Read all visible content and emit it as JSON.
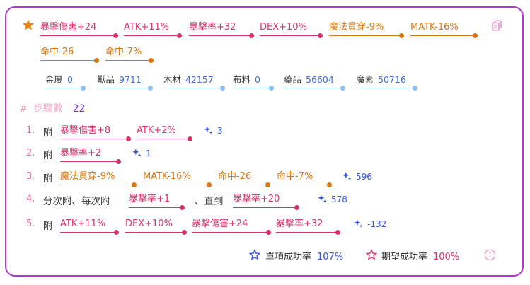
{
  "top_stats": [
    {
      "text": "暴擊傷害+24",
      "color": "pink"
    },
    {
      "text": "ATK+11%",
      "color": "pink"
    },
    {
      "text": "暴擊率+32",
      "color": "pink"
    },
    {
      "text": "DEX+10%",
      "color": "pink"
    },
    {
      "text": "魔法貫穿-9%",
      "color": "orange"
    },
    {
      "text": "MATK-16%",
      "color": "orange"
    },
    {
      "text": "命中-26",
      "color": "orange"
    },
    {
      "text": "命中-7%",
      "color": "orange"
    }
  ],
  "materials": [
    {
      "name": "金屬",
      "value": "0"
    },
    {
      "name": "獸品",
      "value": "9711"
    },
    {
      "name": "木材",
      "value": "42157"
    },
    {
      "name": "布料",
      "value": "0"
    },
    {
      "name": "藥品",
      "value": "56604"
    },
    {
      "name": "魔素",
      "value": "50716"
    }
  ],
  "steps_label": "步驟數",
  "steps_hash": "#",
  "steps_count": "22",
  "steps": [
    {
      "num": "1.",
      "prefix": "附",
      "tags": [
        "暴擊傷害+8",
        "ATK+2%"
      ],
      "gain": "3"
    },
    {
      "num": "2.",
      "prefix": "附",
      "tags": [
        "暴擊率+2"
      ],
      "gain": "1"
    },
    {
      "num": "3.",
      "prefix": "附",
      "tags": [
        "魔法貫穿-9%",
        "MATK-16%",
        "命中-26",
        "命中-7%"
      ],
      "gain": "596"
    },
    {
      "num": "4.",
      "prefix": "分次附、每次附",
      "tags": [
        "暴擊率+1",
        "暴擊率+20"
      ],
      "middle": "、直到",
      "gain": "578"
    },
    {
      "num": "5.",
      "prefix": "附",
      "tags": [
        "ATK+11%",
        "DEX+10%",
        "暴擊傷害+24",
        "暴擊率+32"
      ],
      "gain": "-132"
    }
  ],
  "footer": {
    "single_rate_label": "單項成功率",
    "single_rate_value": "107%",
    "expected_rate_label": "期望成功率",
    "expected_rate_value": "100%"
  },
  "colors": {
    "pink": "#d6336c",
    "orange": "#d9760e",
    "border": "#b234d6",
    "blue": "#3355dd"
  },
  "icons": {
    "favorite": "star-icon",
    "copy": "copy-icon",
    "gain": "sparkle-icon",
    "single": "star-outline-icon",
    "expected": "star-outline-icon",
    "info": "info-icon"
  }
}
